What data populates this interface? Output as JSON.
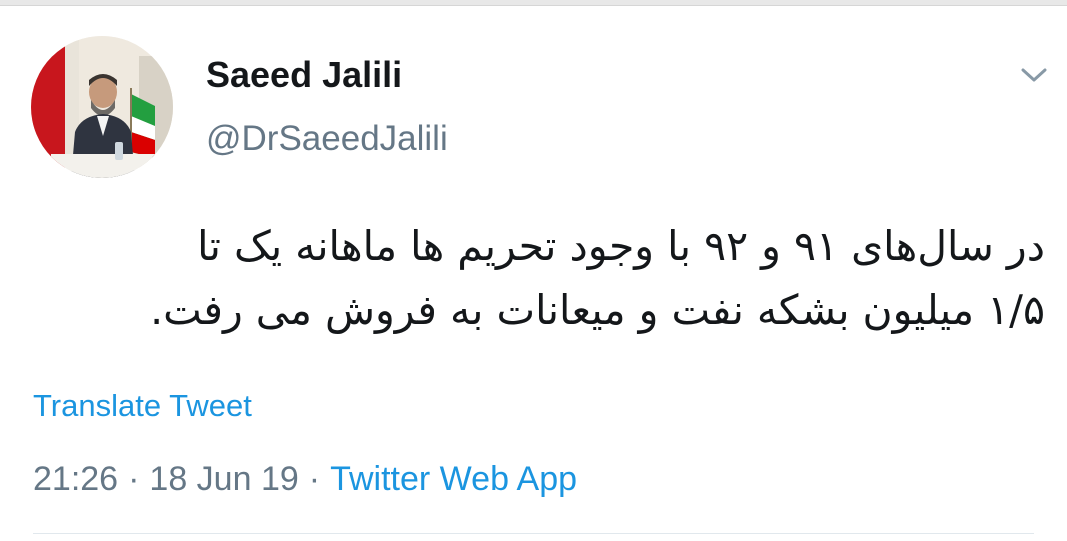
{
  "tweet": {
    "display_name": "Saeed Jalili",
    "handle": "@DrSaeedJalili",
    "text_line_1": "در سال‌های ۹۱ و ۹۲ با وجود تحریم ها ماهانه یک تا",
    "text_line_2": "۱/۵ میلیون بشکه نفت و میعانات به فروش می رفت.",
    "translate_label": "Translate Tweet",
    "time": "21:26",
    "date": "18 Jun 19",
    "separator": "·",
    "source": "Twitter Web App"
  },
  "icons": {
    "avatar": "profile-photo",
    "menu": "chevron-down-icon"
  },
  "colors": {
    "link": "#1b95e0",
    "secondary_text": "#657786",
    "primary_text": "#14171a"
  }
}
